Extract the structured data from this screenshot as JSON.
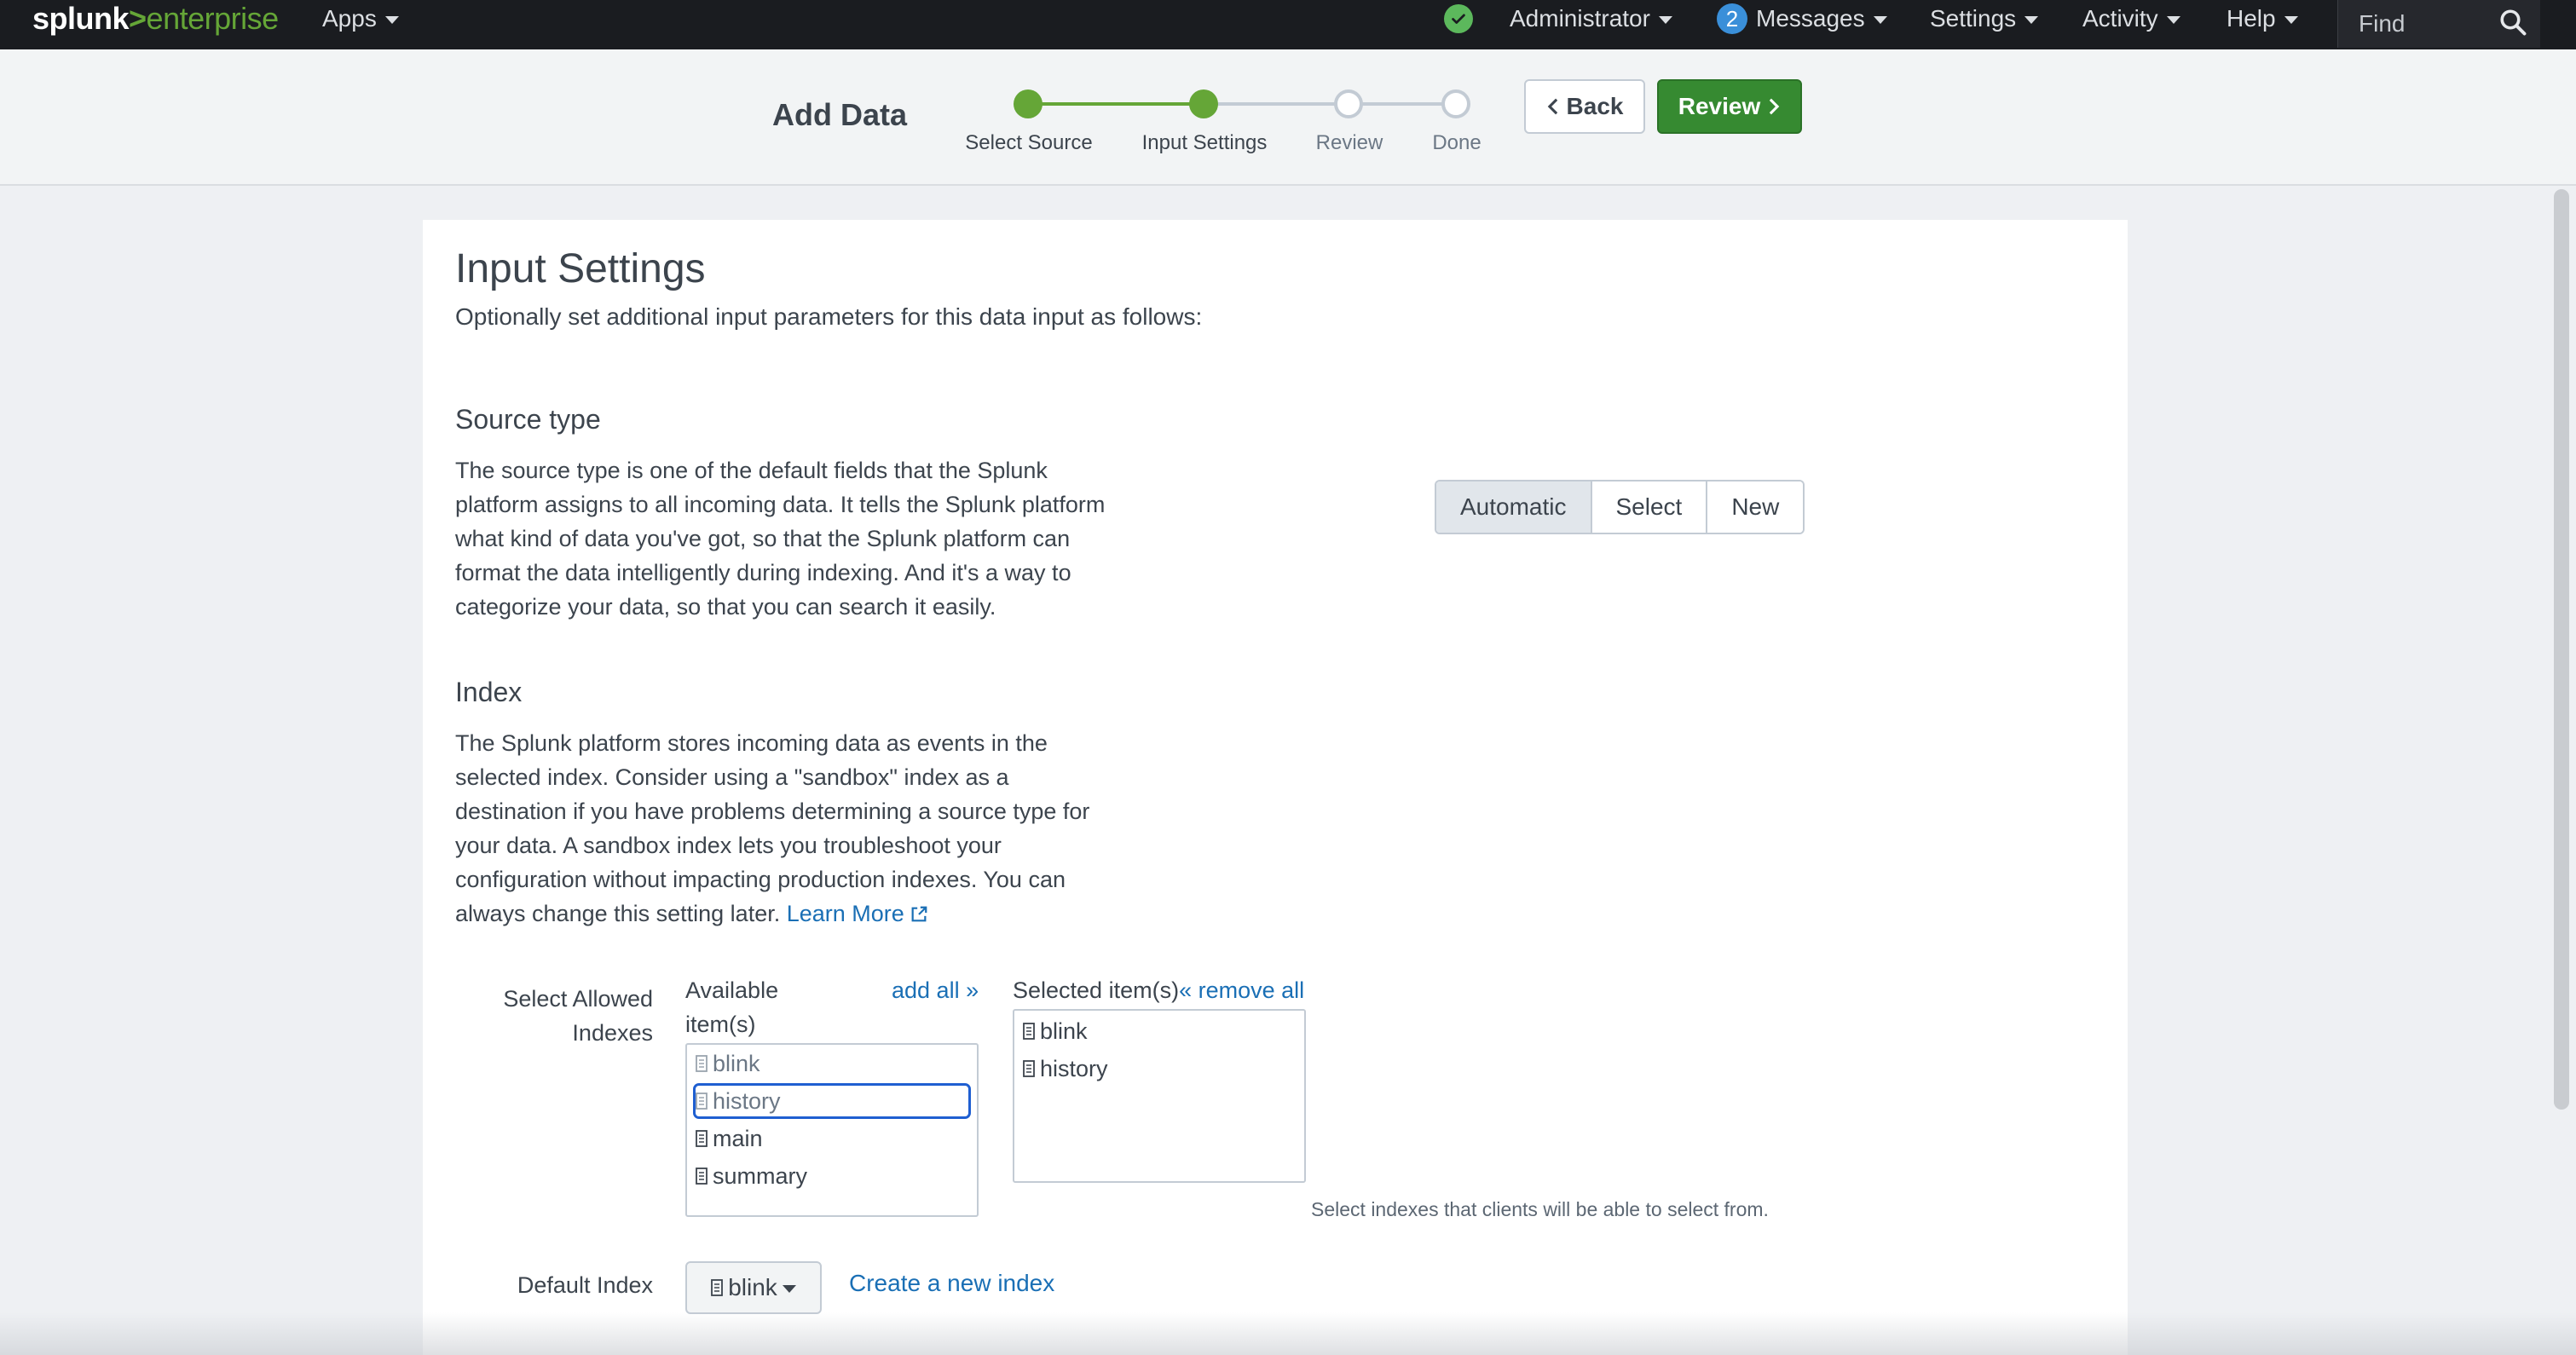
{
  "topnav": {
    "logo_splunk": "splunk",
    "logo_gt": ">",
    "logo_enterprise": "enterprise",
    "apps": "Apps",
    "administrator": "Administrator",
    "messages_count": "2",
    "messages": "Messages",
    "settings": "Settings",
    "activity": "Activity",
    "help": "Help",
    "find": "Find"
  },
  "header": {
    "title": "Add Data",
    "steps": [
      {
        "label": "Select Source",
        "state": "done"
      },
      {
        "label": "Input Settings",
        "state": "done"
      },
      {
        "label": "Review",
        "state": "todo"
      },
      {
        "label": "Done",
        "state": "todo"
      }
    ],
    "back_label": "Back",
    "review_label": "Review"
  },
  "main": {
    "title": "Input Settings",
    "subtitle": "Optionally set additional input parameters for this data input as follows:",
    "source_type": {
      "heading": "Source type",
      "lines": [
        "The source type is one of the default fields that the Splunk",
        "platform assigns to all incoming data. It tells the Splunk platform",
        "what kind of data you've got, so that the Splunk platform can",
        "format the data intelligently during indexing. And it's a way to",
        "categorize your data, so that you can search it easily."
      ],
      "options": [
        "Automatic",
        "Select",
        "New"
      ],
      "selected": "Automatic"
    },
    "index": {
      "heading": "Index",
      "lines": [
        "The Splunk platform stores incoming data as events in the",
        "selected index. Consider using a \"sandbox\" index as a",
        "destination if you have problems determining a source type for",
        "your data. A sandbox index lets you troubleshoot your",
        "configuration without impacting production indexes. You can"
      ],
      "last_line": "always change this setting later.",
      "learn_more": "Learn More"
    },
    "allowed_indexes": {
      "label_line1": "Select Allowed",
      "label_line2": "Indexes",
      "available_line1": "Available",
      "available_line2": "item(s)",
      "add_all": "add all »",
      "selected_head": "Selected item(s)",
      "remove_all": "« remove all",
      "available_items": [
        "blink",
        "history",
        "main",
        "summary"
      ],
      "selected_items": [
        "blink",
        "history"
      ],
      "help": "Select indexes that clients will be able to select from."
    },
    "default_index": {
      "label": "Default Index",
      "value": "blink",
      "create_link": "Create a new index"
    }
  },
  "colors": {
    "nav_bg": "#1a1c20",
    "accent_green": "#65a637",
    "review_button": "#368a31",
    "link": "#1a6fb5",
    "focus": "#1f5fd1"
  }
}
